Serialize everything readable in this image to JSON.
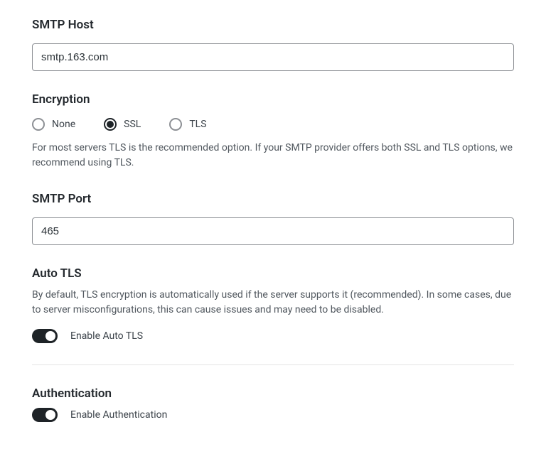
{
  "smtp_host": {
    "label": "SMTP Host",
    "value": "smtp.163.com"
  },
  "encryption": {
    "label": "Encryption",
    "options": {
      "none": "None",
      "ssl": "SSL",
      "tls": "TLS"
    },
    "selected": "ssl",
    "description": "For most servers TLS is the recommended option. If your SMTP provider offers both SSL and TLS options, we recommend using TLS."
  },
  "smtp_port": {
    "label": "SMTP Port",
    "value": "465"
  },
  "auto_tls": {
    "label": "Auto TLS",
    "description": "By default, TLS encryption is automatically used if the server supports it (recommended). In some cases, due to server misconfigurations, this can cause issues and may need to be disabled.",
    "toggle_label": "Enable Auto TLS",
    "enabled": true
  },
  "authentication": {
    "label": "Authentication",
    "toggle_label": "Enable Authentication",
    "enabled": true
  }
}
